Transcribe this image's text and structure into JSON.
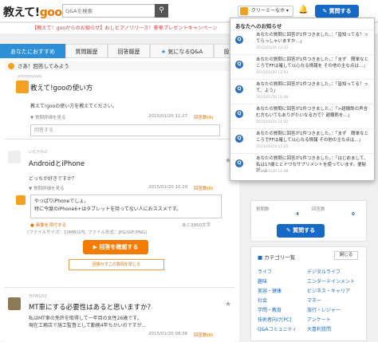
{
  "header": {
    "logo_a": "教えて!",
    "logo_b": "goo",
    "search_placeholder": "Q&Aを検索",
    "search_icon": "search-icon",
    "user_name": "クリーミーなホ",
    "ask_label": "質問する"
  },
  "notice": "【教えて！gooからのお知らせ】おしビアノリリース！豪華プレゼントキャンペーン",
  "tabs": [
    "あなたにおすすめ",
    "質問履歴",
    "回答履歴",
    "気になるQ&A",
    "設"
  ],
  "feed": {
    "prompt": "さあ！回答してみよう",
    "q1": {
      "user": "yoyoyoyoyo",
      "title": "教えて!gooの使い方",
      "body": "教えて!gooの使い方を教えてください。",
      "date": "2015/01/20 11:27",
      "ans": "回答数(4)",
      "detail": "質問詳細を見る",
      "placeholder": "回答する"
    },
    "q2": {
      "user": "いむかわ2",
      "title": "AndroidとiPhone",
      "body": "どっちが好きですか？",
      "detail": "質問詳細を見る",
      "date": "2015/01/20 10:20",
      "ans": "回答数(0)",
      "draft1": "やっぱりiPhoneでしょ。",
      "draft2": "特に今度のiPhone6+はタブレットを持ってない人におススメです。",
      "upload": "画像を添付する",
      "limit": "あと3950文字",
      "filesize": "(ファイルサイズ：10MB以内, ファイル形式：JPG/GIF/PNG)",
      "confirm": "回答を確認する",
      "skip": "回答せずこの質問を閉じる"
    },
    "q3": {
      "user": "YIPWGS3",
      "title": "MT車にする必要性はあると思いますか？",
      "body1": "私はMT車の免許を取得して一年目の女性26歳です。",
      "body2": "現在工務店で施工監督として勤務4年ちかいのですが...",
      "date": "2015/01/20 08:36",
      "ans": "回答数(0)"
    }
  },
  "right": {
    "q_hist": "質問数",
    "a_hist": "回答数",
    "q_count": "4",
    "a_count": "0",
    "ask": "質問する",
    "cat_title": "カテゴリ一覧",
    "close": "閉じる",
    "cats": [
      "ライフ",
      "デジタルライフ",
      "趣味",
      "エンターテインメント",
      "美容・健康",
      "ビジネス・キャリア",
      "社会",
      "マネー",
      "学問・教育",
      "旅行・レジャー",
      "技術者向け[PC]",
      "アンケート",
      "Q&Aコミュニティ",
      "大喜利質問"
    ]
  },
  "dropdown": {
    "title": "あなたへのお知らせ",
    "items": [
      {
        "text": "あなたの質問に回答が1件つきました。：「皆知ってる？ってらっしゃいますか…」",
        "date": "2015/01/20 12:32"
      },
      {
        "text": "あなたの質問に回答が1件つきました。：「まず　簡単なところでFFは確して以心なる情報を その他の主な点は…」",
        "date": "2015/01/20 12:03"
      },
      {
        "text": "あなたの質問に回答が1件つきました。：「皆知ってる？って、よう」",
        "date": "2015/01/20 11:48"
      },
      {
        "text": "あなたの質問に回答が1件つきました。：「>趙穂郎の声含む方もいてもありがたいなる方で？趙穂郎を…」",
        "date": "2015/01/20 11:32"
      },
      {
        "text": "あなたの質問に回答が1件つきました。：「まず　簡単なところでFFは確して以心なる情報 その他の主な点は…」",
        "date": "2015/01/20 11:20"
      },
      {
        "text": "あなたの質問に回答が1件つきました。：「はじめまして、私は17歳ととドワなサプリメントを使っています。便秘が…」",
        "date": "2015/01/20 11:08"
      }
    ]
  },
  "colors": {
    "accent": "#1769c6",
    "orange": "#f57c00",
    "tab": "#2d8fd5"
  }
}
